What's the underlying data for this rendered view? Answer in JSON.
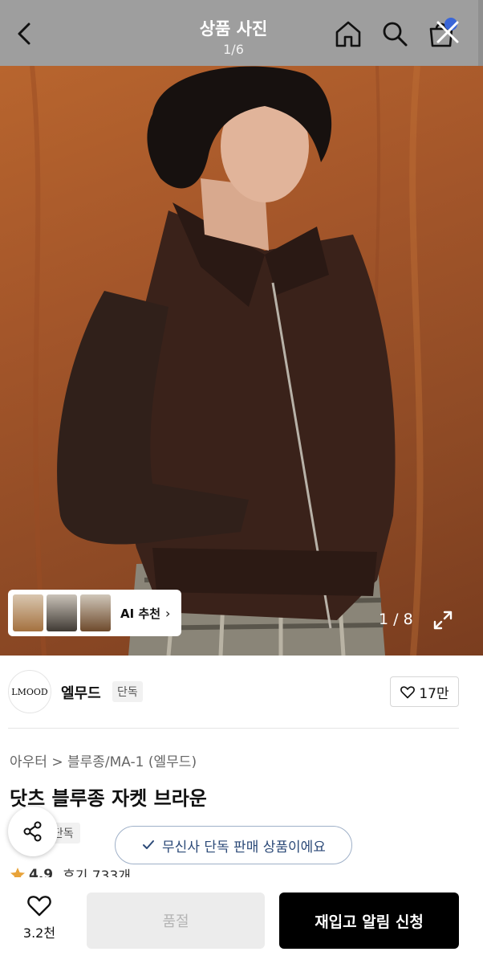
{
  "header": {
    "title": "상품 사진",
    "counter": "1/6"
  },
  "hero": {
    "ai_label": "AI 추천",
    "index": "1 / 8"
  },
  "brand": {
    "logo_text": "LMOOD",
    "name": "엘무드",
    "badge": "단독",
    "likes": "17만"
  },
  "product": {
    "breadcrumb": "아우터 > 블루종/MA-1 (엘무드)",
    "title": "닷츠 블루종 자켓 브라운",
    "badge": "단독",
    "rating": "4.9",
    "reviews": "후기 733개"
  },
  "toast": {
    "text": "무신사 단독 판매 상품이에요"
  },
  "bottom": {
    "wish_count": "3.2천",
    "sold_out": "품절",
    "restock": "재입고 알림 신청"
  },
  "colors": {
    "accent_black": "#000000",
    "toast_text": "#2c4a78",
    "star": "#e8a33a"
  }
}
